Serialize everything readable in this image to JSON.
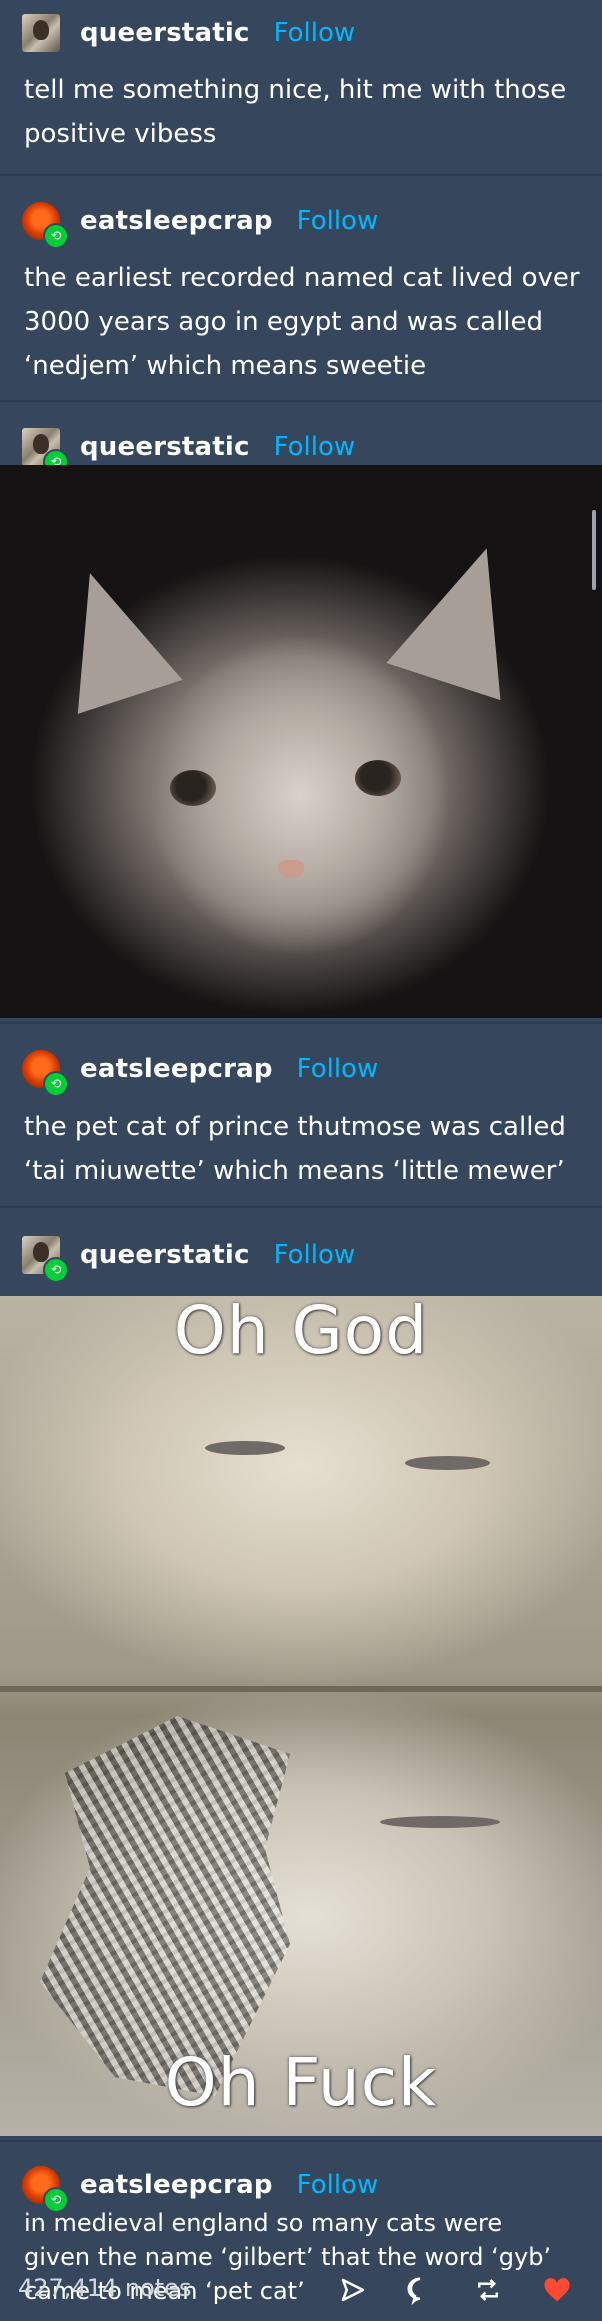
{
  "posts": [
    {
      "user": "queerstatic",
      "follow": "Follow",
      "reblog": false,
      "text": [
        "tell me something nice, hit me with those",
        "positive vibess"
      ]
    },
    {
      "user": "eatsleepcrap",
      "follow": "Follow",
      "reblog": true,
      "text": [
        "the earliest recorded named cat lived over",
        "3000 years ago in egypt and was called",
        "‘nedjem’ which means sweetie"
      ]
    },
    {
      "user": "queerstatic",
      "follow": "Follow",
      "reblog": true
    },
    {
      "user": "eatsleepcrap",
      "follow": "Follow",
      "reblog": true,
      "text": [
        "the pet cat of prince thutmose was called",
        "‘tai miuwette’ which means ‘little mewer’"
      ]
    },
    {
      "user": "queerstatic",
      "follow": "Follow",
      "reblog": true
    },
    {
      "user": "eatsleepcrap",
      "follow": "Follow",
      "reblog": true,
      "text": [
        "in medieval england so many cats were",
        "given the name ‘gilbert’ that the word ‘gyb’",
        "came to mean ‘pet cat’"
      ]
    }
  ],
  "meme": {
    "top": "Oh God",
    "bottom": "Oh Fuck"
  },
  "footer": {
    "notes": "427,414 notes"
  },
  "icons": {
    "share": "share-icon",
    "reply": "reply-icon",
    "reblog": "reblog-icon",
    "like": "heart-icon"
  },
  "colors": {
    "background": "#36465d",
    "follow": "#00b8ff",
    "reblog_badge": "#00cf35",
    "heart": "#ff4930"
  }
}
